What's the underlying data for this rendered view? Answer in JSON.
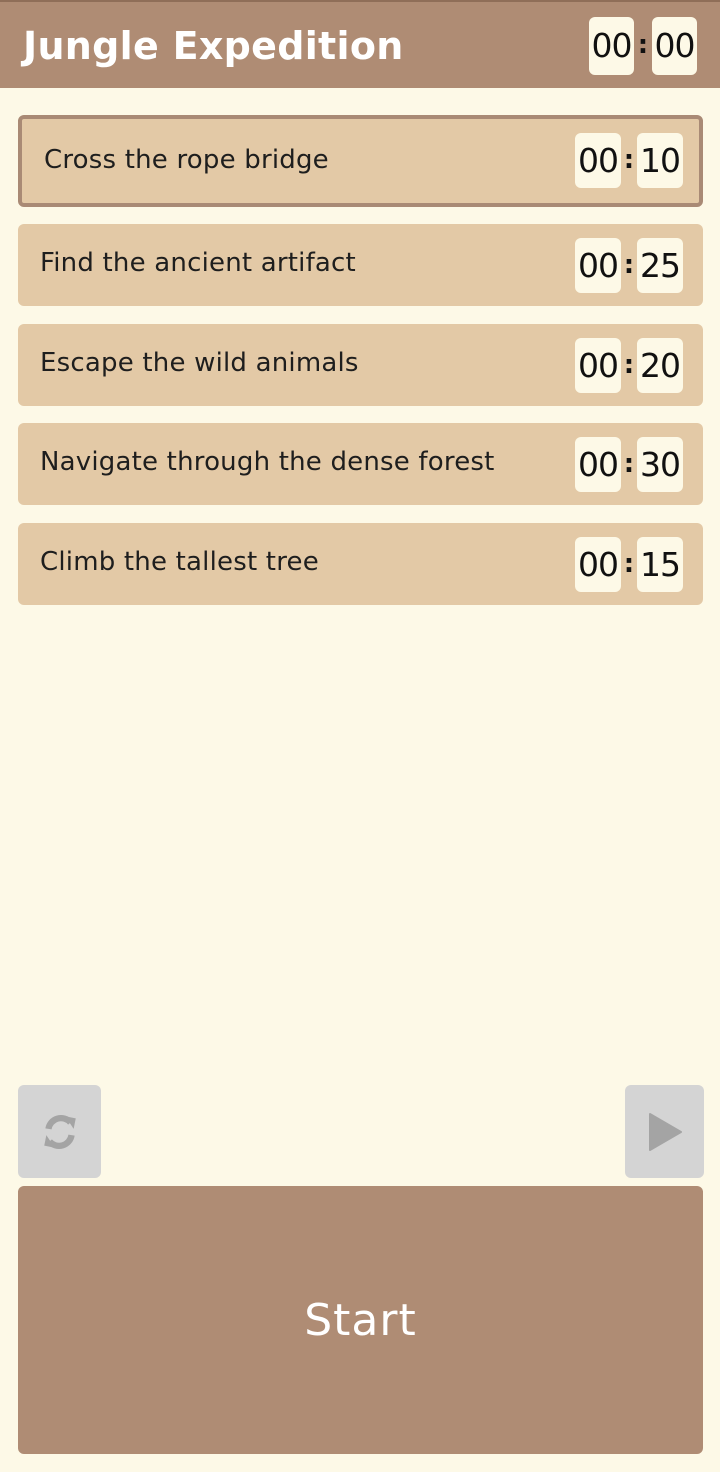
{
  "header": {
    "title": "Jungle Expedition",
    "timer": {
      "minutes": "00",
      "colon": ":",
      "seconds": "00"
    }
  },
  "tasks": [
    {
      "label": "Cross the rope bridge",
      "minutes": "00",
      "seconds": "10",
      "active": true
    },
    {
      "label": "Find the ancient artifact",
      "minutes": "00",
      "seconds": "25",
      "active": false
    },
    {
      "label": "Escape the wild animals",
      "minutes": "00",
      "seconds": "20",
      "active": false
    },
    {
      "label": "Navigate through the dense forest",
      "minutes": "00",
      "seconds": "30",
      "active": false
    },
    {
      "label": "Climb the tallest tree",
      "minutes": "00",
      "seconds": "15",
      "active": false
    }
  ],
  "colon": ":",
  "controls": {
    "reset_icon": "refresh-icon",
    "play_icon": "play-icon",
    "start_label": "Start"
  },
  "colors": {
    "accent": "#af8c74",
    "task_background": "#e3c9a6",
    "page_background": "#fdf9e7",
    "control_disabled": "#d4d4d4",
    "icon_disabled": "#a4a4a4"
  }
}
